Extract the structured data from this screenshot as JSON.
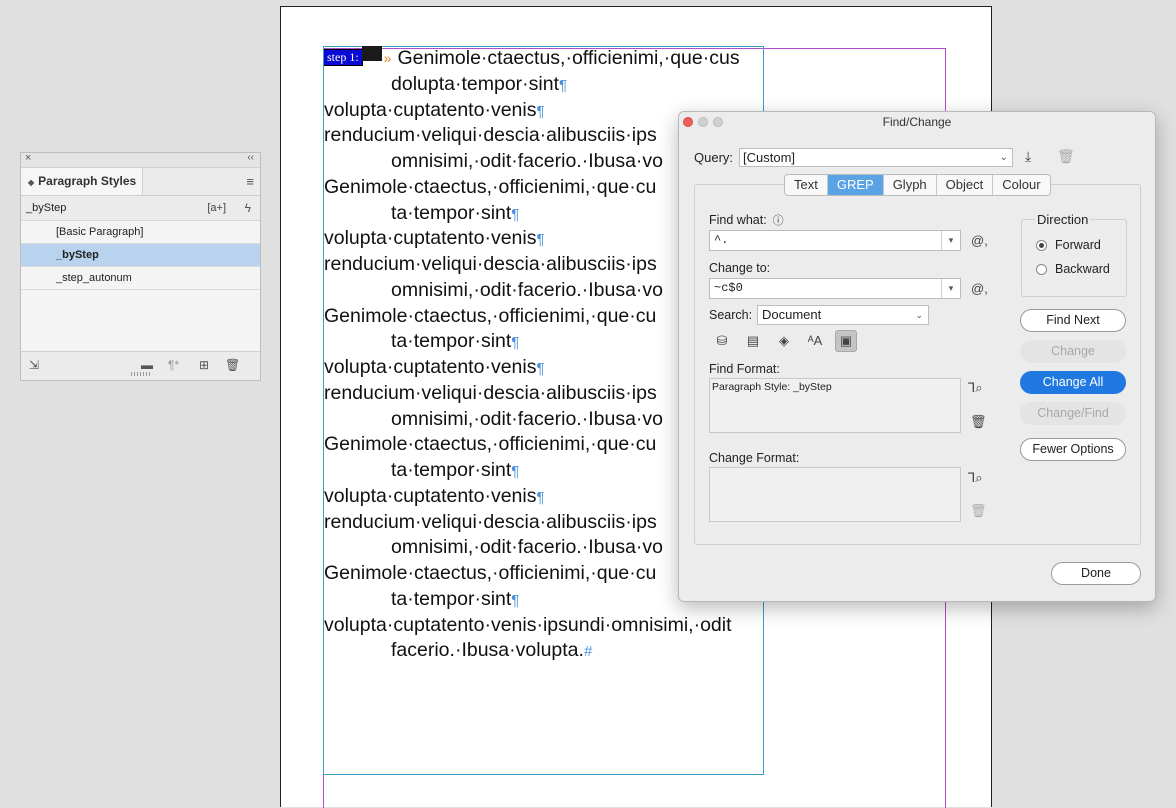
{
  "story": {
    "step_tag": "step 1:",
    "lines": [
      {
        "text": "Genimole·ctaectus,·officienimi,·que·cus",
        "indent": false,
        "mark": ""
      },
      {
        "text": "dolupta·tempor·sint",
        "indent": true,
        "mark": "¶"
      },
      {
        "text": "volupta·cuptatento·venis",
        "indent": false,
        "mark": "¶"
      },
      {
        "text": "renducium·veliqui·descia·alibusciis·ips",
        "indent": false,
        "mark": ""
      },
      {
        "text": "omnisimi,·odit·facerio.·Ibusa·vo",
        "indent": true,
        "mark": ""
      },
      {
        "text": "Genimole·ctaectus,·officienimi,·que·cu",
        "indent": false,
        "mark": ""
      },
      {
        "text": "ta·tempor·sint",
        "indent": true,
        "mark": "¶"
      },
      {
        "text": "volupta·cuptatento·venis",
        "indent": false,
        "mark": "¶"
      },
      {
        "text": "renducium·veliqui·descia·alibusciis·ips",
        "indent": false,
        "mark": ""
      },
      {
        "text": "omnisimi,·odit·facerio.·Ibusa·vo",
        "indent": true,
        "mark": ""
      },
      {
        "text": "Genimole·ctaectus,·officienimi,·que·cu",
        "indent": false,
        "mark": ""
      },
      {
        "text": "ta·tempor·sint",
        "indent": true,
        "mark": "¶"
      },
      {
        "text": "volupta·cuptatento·venis",
        "indent": false,
        "mark": "¶"
      },
      {
        "text": "renducium·veliqui·descia·alibusciis·ips",
        "indent": false,
        "mark": ""
      },
      {
        "text": "omnisimi,·odit·facerio.·Ibusa·vo",
        "indent": true,
        "mark": ""
      },
      {
        "text": "Genimole·ctaectus,·officienimi,·que·cu",
        "indent": false,
        "mark": ""
      },
      {
        "text": "ta·tempor·sint",
        "indent": true,
        "mark": "¶"
      },
      {
        "text": "volupta·cuptatento·venis",
        "indent": false,
        "mark": "¶"
      },
      {
        "text": "renducium·veliqui·descia·alibusciis·ips",
        "indent": false,
        "mark": ""
      },
      {
        "text": "omnisimi,·odit·facerio.·Ibusa·vo",
        "indent": true,
        "mark": ""
      },
      {
        "text": "Genimole·ctaectus,·officienimi,·que·cu",
        "indent": false,
        "mark": ""
      },
      {
        "text": "ta·tempor·sint",
        "indent": true,
        "mark": "¶"
      },
      {
        "text": "volupta·cuptatento·venis·ipsundi·omnisimi,·odit",
        "indent": false,
        "mark": ""
      },
      {
        "text": "facerio.·Ibusa·volupta.",
        "indent": true,
        "mark": "#"
      }
    ]
  },
  "paragraph_styles": {
    "title": "Paragraph Styles",
    "current": "_byStep",
    "new_group_label": "[a+]",
    "items": [
      {
        "label": "[Basic Paragraph]",
        "selected": false
      },
      {
        "label": "_byStep",
        "selected": true
      },
      {
        "label": "_step_autonum",
        "selected": false
      }
    ]
  },
  "find_change": {
    "title": "Find/Change",
    "query_label": "Query:",
    "query_value": "[Custom]",
    "tabs": [
      "Text",
      "GREP",
      "Glyph",
      "Object",
      "Colour"
    ],
    "active_tab": "GREP",
    "find_what_label": "Find what:",
    "find_what_value": "^.",
    "change_to_label": "Change to:",
    "change_to_value": "~c$0",
    "search_label": "Search:",
    "search_value": "Document",
    "find_format_label": "Find Format:",
    "find_format_value": "Paragraph Style: _byStep",
    "change_format_label": "Change Format:",
    "change_format_value": "",
    "direction_label": "Direction",
    "forward_label": "Forward",
    "backward_label": "Backward",
    "direction_selected": "Forward",
    "buttons": {
      "find_next": "Find Next",
      "change": "Change",
      "change_all": "Change All",
      "change_find": "Change/Find",
      "fewer_options": "Fewer Options",
      "done": "Done"
    }
  },
  "colors": {
    "accent": "#1f79e0",
    "grep_tab": "#5aa4e6",
    "selected_row": "#b9d3ee",
    "margin_guide": "#b44bc8",
    "frame_edge": "#3aa0c8",
    "step_tag": "#0a0ad6"
  }
}
